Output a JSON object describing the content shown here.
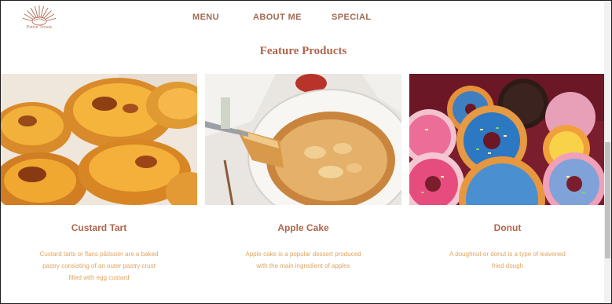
{
  "brand": {
    "name": "Petite Treats",
    "color": "#b06a52"
  },
  "nav": {
    "items": [
      "MENU",
      "ABOUT ME",
      "SPECIAL"
    ]
  },
  "section": {
    "title": "Feature Products"
  },
  "products": [
    {
      "title": "Custard Tart",
      "description": "Custard tarts or flans pâtissier are a baked pastry consisting of an outer pastry crust filled with egg custard",
      "image": "custard-tarts-photo"
    },
    {
      "title": "Apple Cake",
      "description": "Apple cake is a popular dessert produced with the main ingredient of apples",
      "image": "apple-cake-photo"
    },
    {
      "title": "Donut",
      "description": "A doughnut or donut is a type of leavened fried dough",
      "image": "donuts-photo"
    }
  ],
  "colors": {
    "accent": "#b0654d",
    "desc": "#e0a55f",
    "nav": "#a06a52"
  }
}
